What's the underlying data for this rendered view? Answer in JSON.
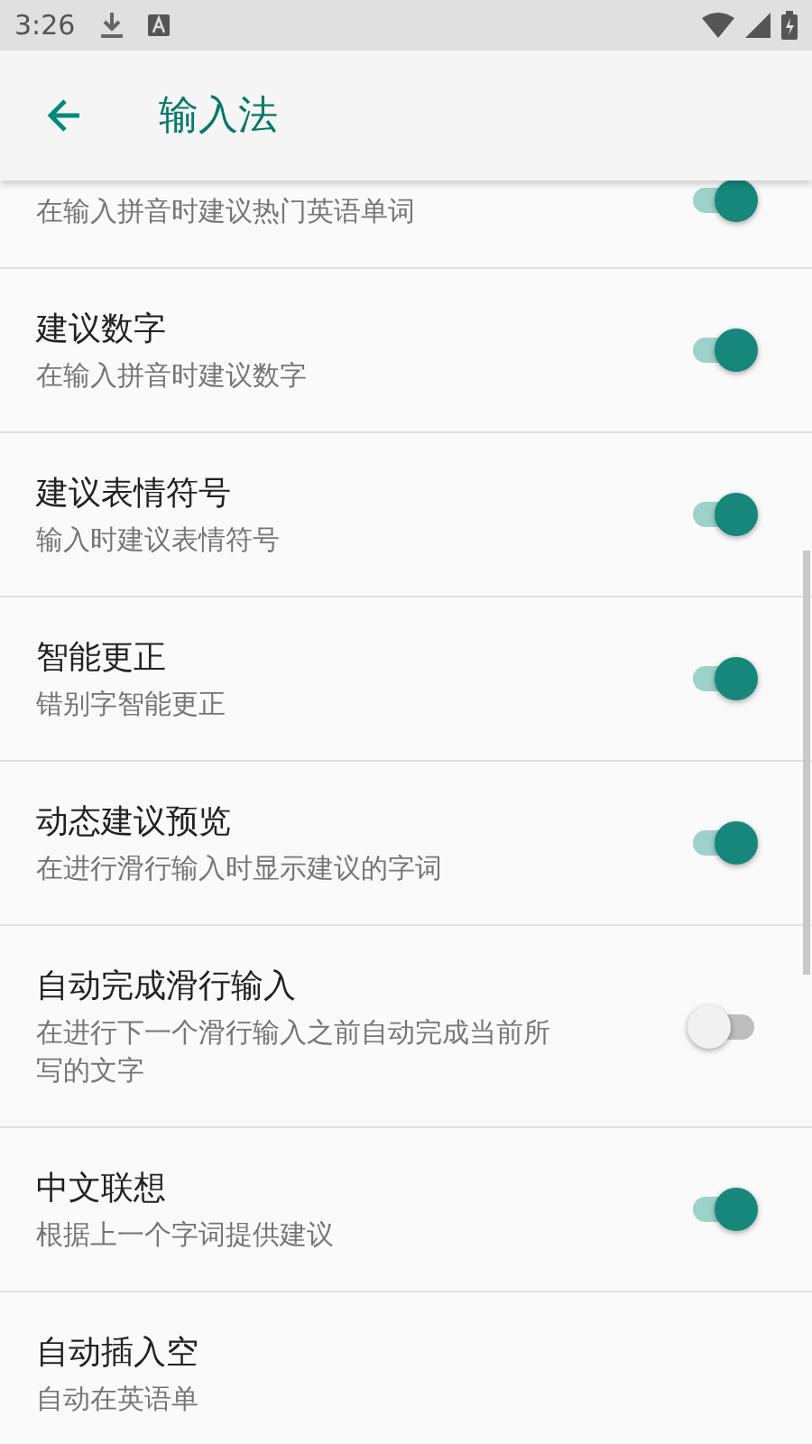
{
  "status_bar": {
    "time": "3:26"
  },
  "app_bar": {
    "title": "输入法"
  },
  "settings": [
    {
      "subtitle": "在输入拼音时建议热门英语单词",
      "on": true,
      "cut": true
    },
    {
      "title": "建议数字",
      "subtitle": "在输入拼音时建议数字",
      "on": true
    },
    {
      "title": "建议表情符号",
      "subtitle": "输入时建议表情符号",
      "on": true
    },
    {
      "title": "智能更正",
      "subtitle": "错别字智能更正",
      "on": true
    },
    {
      "title": "动态建议预览",
      "subtitle": "在进行滑行输入时显示建议的字词",
      "on": true
    },
    {
      "title": "自动完成滑行输入",
      "subtitle": "在进行下一个滑行输入之前自动完成当前所写的文字",
      "on": false
    },
    {
      "title": "中文联想",
      "subtitle": "根据上一个字词提供建议",
      "on": true
    },
    {
      "title": "自动插入空",
      "subtitle": "自动在英语单"
    }
  ]
}
